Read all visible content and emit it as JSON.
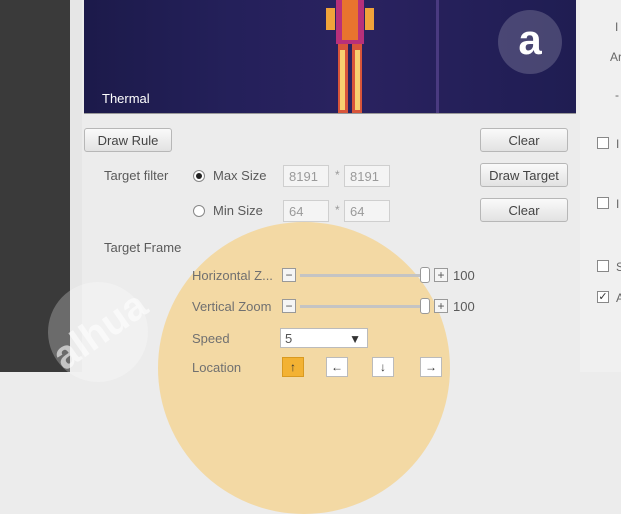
{
  "video": {
    "label": "Thermal"
  },
  "buttons": {
    "draw_rule": "Draw Rule",
    "clear_rule": "Clear",
    "draw_target": "Draw Target",
    "clear_target": "Clear"
  },
  "target_filter": {
    "label": "Target filter",
    "max_size": {
      "label": "Max Size",
      "width": "8191",
      "height": "8191",
      "selected": true
    },
    "min_size": {
      "label": "Min Size",
      "width": "64",
      "height": "64",
      "selected": false
    },
    "separator": "*"
  },
  "target_frame": {
    "label": "Target Frame",
    "horizontal_zoom": {
      "label": "Horizontal Z...",
      "value": "100"
    },
    "vertical_zoom": {
      "label": "Vertical Zoom",
      "value": "100"
    },
    "speed": {
      "label": "Speed",
      "value": "5"
    },
    "location": {
      "label": "Location"
    }
  },
  "right_panel": {
    "text_stub": "Ar",
    "checkbox_4_checked": true
  },
  "colors": {
    "accent": "#f3b233",
    "overlay": "#f7cd78"
  }
}
